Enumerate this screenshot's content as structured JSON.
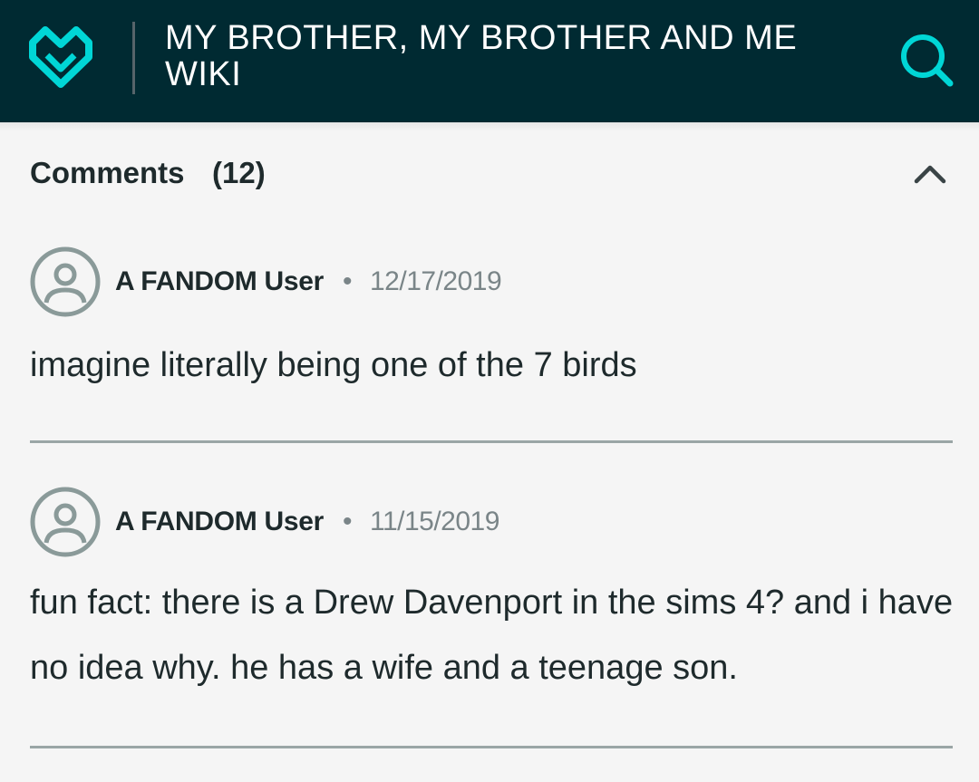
{
  "header": {
    "wiki_title": "MY BROTHER, MY BROTHER AND ME WIKI",
    "logo_icon": "fandom-heart-logo-icon",
    "search_icon": "search-icon",
    "bg_color": "#002a32",
    "accent_color": "#00d6d6"
  },
  "comments": {
    "title": "Comments",
    "count": "(12)",
    "collapse_icon": "chevron-up-icon",
    "items": [
      {
        "author": "A FANDOM User",
        "separator": "•",
        "date": "12/17/2019",
        "text": "imagine literally being one of the 7 birds"
      },
      {
        "author": "A FANDOM User",
        "separator": "•",
        "date": "11/15/2019",
        "text": "fun fact: there is a Drew Davenport in the sims 4? and i have no idea why. he has a wife and a teenage son."
      }
    ]
  }
}
